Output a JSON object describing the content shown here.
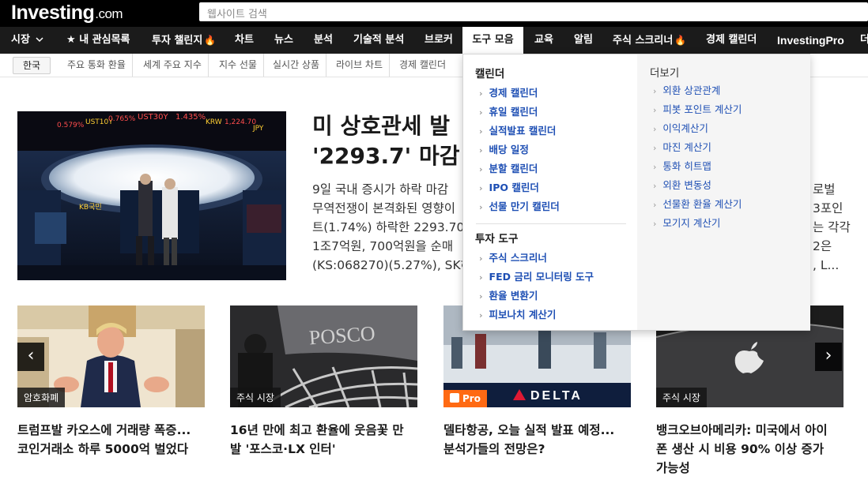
{
  "logo": {
    "name": "Investing",
    "suffix": ".com"
  },
  "search": {
    "placeholder": "웹사이트 검색"
  },
  "nav": {
    "items": [
      {
        "label": "시장"
      },
      {
        "label": "내 관심목록"
      },
      {
        "label": "투자 챌린지"
      },
      {
        "label": "차트"
      },
      {
        "label": "뉴스"
      },
      {
        "label": "분석"
      },
      {
        "label": "기술적 분석"
      },
      {
        "label": "브로커"
      },
      {
        "label": "도구 모음"
      },
      {
        "label": "교육"
      },
      {
        "label": "알림"
      },
      {
        "label": "주식 스크리너"
      },
      {
        "label": "경제 캘린더"
      },
      {
        "label": "InvestingPro"
      },
      {
        "label": "더"
      }
    ]
  },
  "subnav": {
    "region": "한국",
    "items": [
      "주요 통화 환율",
      "세계 주요 지수",
      "지수 선물",
      "실시간 상품",
      "라이브 차트",
      "경제 캘린더"
    ]
  },
  "hero": {
    "title_line1": "미 상호관세 발",
    "title_line2": "'2293.7' 마감",
    "body": [
      "9일 국내 증시가 하락 마감",
      "무역전쟁이 본격화된 영향이",
      "트(1.74%) 하락한 2293.70",
      "1조7억원, 700억원을 순매",
      "(KS:068270)(5.27%), SK하"
    ],
    "body_right": [
      "로벌",
      "3포인",
      "는 각각",
      "2은",
      ", L..."
    ]
  },
  "cards": [
    {
      "tag": "암호화폐",
      "title_line1": "트럼프발 카오스에 거래량 폭증...",
      "title_line2": "코인거래소 하루 5000억 벌었다"
    },
    {
      "tag": "주식 시장",
      "title_line1": "16년 만에 최고 환율에 웃음꽃 만",
      "title_line2": "발 '포스코·LX 인터'"
    },
    {
      "tag": "Pro",
      "title_line1": "델타항공, 오늘 실적 발표 예정...",
      "title_line2": "분석가들의 전망은?"
    },
    {
      "tag": "주식 시장",
      "title_line1": "뱅크오브아메리카: 미국에서 아이",
      "title_line2": "폰 생산 시 비용 90% 이상 증가",
      "title_line3": "가능성"
    }
  ],
  "dropdown": {
    "calendars": {
      "heading": "캘린더",
      "links": [
        "경제 캘린더",
        "휴일 캘린더",
        "실적발표 캘린더",
        "배당 일정",
        "분할 캘린더",
        "IPO 캘린더",
        "선물 만기 캘린더"
      ]
    },
    "tools": {
      "heading": "투자 도구",
      "links": [
        "주식 스크리너",
        "FED 금리 모니터링 도구",
        "환율 변환기",
        "피보나치 계산기"
      ]
    },
    "more": {
      "heading": "더보기",
      "links": [
        "외환 상관관계",
        "피봇 포인트 계산기",
        "이익계산기",
        "마진 계산기",
        "통화 히트맵",
        "외환 변동성",
        "선물환 환율 계산기",
        "모기지 계산기"
      ]
    }
  },
  "image_text": {
    "ticker": [
      "0.579%",
      "UST10Y",
      "0.765%",
      "UST30Y",
      "1.435%",
      "KRW",
      "1,224.70",
      "JPY"
    ],
    "kb_logo": "KB국민",
    "posco": "POSCO",
    "delta": "DELTA"
  },
  "colors": {
    "accent": "#ff7a1a",
    "link": "#1e4fb4",
    "nav_bg": "#1b1b1b"
  }
}
